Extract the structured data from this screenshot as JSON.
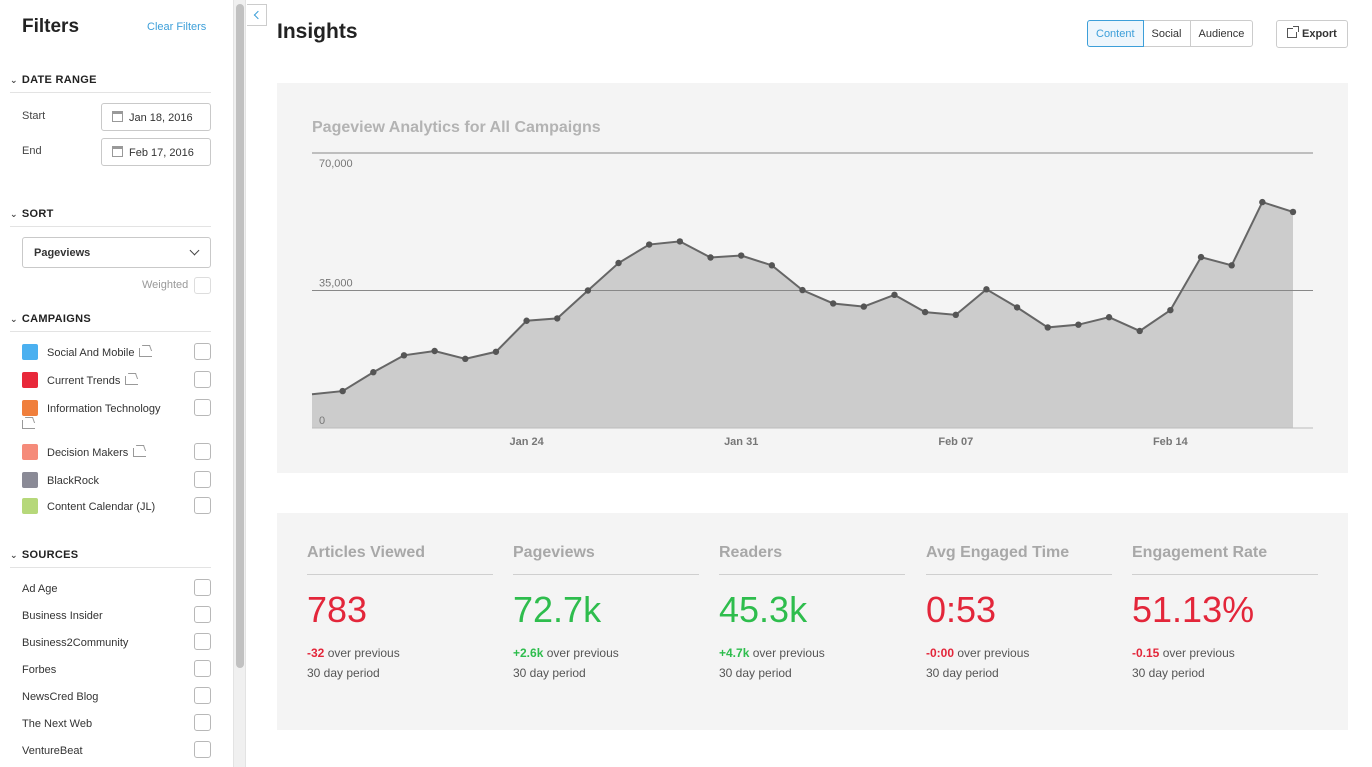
{
  "sidebar": {
    "title": "Filters",
    "clear_label": "Clear Filters",
    "date_range": {
      "heading": "DATE RANGE",
      "start_label": "Start",
      "start_value": "Jan 18, 2016",
      "end_label": "End",
      "end_value": "Feb 17, 2016"
    },
    "sort": {
      "heading": "SORT",
      "selected": "Pageviews",
      "weighted_label": "Weighted"
    },
    "campaigns": {
      "heading": "CAMPAIGNS",
      "items": [
        {
          "label": "Social And Mobile",
          "color": "#4bb0f0"
        },
        {
          "label": "Current Trends",
          "color": "#e8283a"
        },
        {
          "label": "Information Technology",
          "color": "#f07f3c"
        },
        {
          "label": "Decision Makers",
          "color": "#f58b7a"
        },
        {
          "label": "BlackRock",
          "color": "#8a8a96"
        },
        {
          "label": "Content Calendar (JL)",
          "color": "#b6d87a"
        }
      ]
    },
    "sources": {
      "heading": "SOURCES",
      "items": [
        "Ad Age",
        "Business Insider",
        "Business2Community",
        "Forbes",
        "NewsCred Blog",
        "The Next Web",
        "VentureBeat"
      ]
    }
  },
  "main": {
    "title": "Insights",
    "tabs": [
      "Content",
      "Social",
      "Audience"
    ],
    "export_label": "Export"
  },
  "chart_data": {
    "type": "area",
    "title": "Pageview Analytics for All Campaigns",
    "x_tick_labels": [
      "Jan 24",
      "Jan 31",
      "Feb 07",
      "Feb 14"
    ],
    "y_tick_labels": [
      "0",
      "35,000",
      "70,000"
    ],
    "ylim": [
      0,
      70000
    ],
    "x": [
      "Jan 18",
      "Jan 19",
      "Jan 20",
      "Jan 21",
      "Jan 22",
      "Jan 23",
      "Jan 24",
      "Jan 25",
      "Jan 26",
      "Jan 27",
      "Jan 28",
      "Jan 29",
      "Jan 30",
      "Jan 31",
      "Feb 01",
      "Feb 02",
      "Feb 03",
      "Feb 04",
      "Feb 05",
      "Feb 06",
      "Feb 07",
      "Feb 08",
      "Feb 09",
      "Feb 10",
      "Feb 11",
      "Feb 12",
      "Feb 13",
      "Feb 14",
      "Feb 15",
      "Feb 16",
      "Feb 17"
    ],
    "values": [
      8600,
      9400,
      14200,
      18500,
      19600,
      17600,
      19400,
      27300,
      27900,
      35000,
      42000,
      46700,
      47500,
      43400,
      43900,
      41400,
      35100,
      31700,
      30900,
      33900,
      29500,
      28800,
      35300,
      30700,
      25600,
      26300,
      28200,
      24700,
      30000,
      43500,
      41400,
      57500,
      55000
    ],
    "series_color": "#666666",
    "fill_color": "#cccccc",
    "grid": true
  },
  "stats": [
    {
      "label": "Articles Viewed",
      "value": "783",
      "delta": "-32",
      "delta_suffix": "over previous",
      "period": "30 day period",
      "color": "red"
    },
    {
      "label": "Pageviews",
      "value": "72.7k",
      "delta": "+2.6k",
      "delta_suffix": "over previous",
      "period": "30 day period",
      "color": "green"
    },
    {
      "label": "Readers",
      "value": "45.3k",
      "delta": "+4.7k",
      "delta_suffix": "over previous",
      "period": "30 day period",
      "color": "green"
    },
    {
      "label": "Avg Engaged Time",
      "value": "0:53",
      "delta": "-0:00",
      "delta_suffix": "over previous",
      "period": "30 day period",
      "color": "red"
    },
    {
      "label": "Engagement Rate",
      "value": "51.13%",
      "delta": "-0.15",
      "delta_suffix": "over previous",
      "period": "30 day period",
      "color": "red"
    }
  ]
}
